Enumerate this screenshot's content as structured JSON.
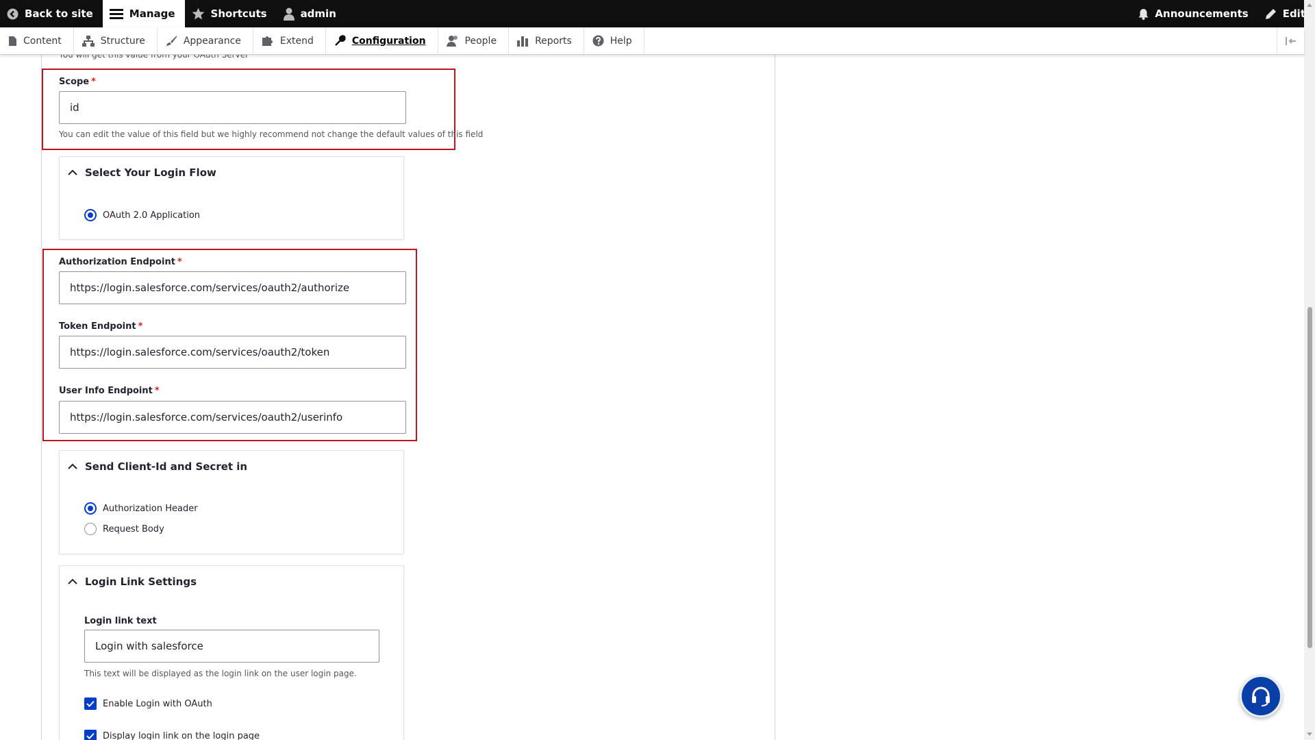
{
  "toolbar": {
    "back": "Back to site",
    "manage": "Manage",
    "shortcuts": "Shortcuts",
    "user": "admin",
    "announcements": "Announcements",
    "edit": "Edit"
  },
  "tray": {
    "items": [
      {
        "label": "Content",
        "icon": "file-icon"
      },
      {
        "label": "Structure",
        "icon": "sitemap-icon"
      },
      {
        "label": "Appearance",
        "icon": "paintbrush-icon"
      },
      {
        "label": "Extend",
        "icon": "puzzle-icon"
      },
      {
        "label": "Configuration",
        "icon": "wrench-icon",
        "active": true
      },
      {
        "label": "People",
        "icon": "people-icon"
      },
      {
        "label": "Reports",
        "icon": "bar-chart-icon"
      },
      {
        "label": "Help",
        "icon": "question-icon"
      }
    ]
  },
  "form": {
    "cut_off_desc": "You will get this value from your OAuth Server",
    "scope": {
      "label": "Scope",
      "required_mark": "*",
      "value": "id",
      "description": "You can edit the value of this field but we highly recommend not change the default values of this field"
    },
    "login_flow": {
      "title": "Select Your Login Flow",
      "options": [
        "OAuth 2.0 Application"
      ]
    },
    "authorization_endpoint": {
      "label": "Authorization Endpoint",
      "value": "https://login.salesforce.com/services/oauth2/authorize"
    },
    "token_endpoint": {
      "label": "Token Endpoint",
      "value": "https://login.salesforce.com/services/oauth2/token"
    },
    "userinfo_endpoint": {
      "label": "User Info Endpoint",
      "value": "https://login.salesforce.com/services/oauth2/userinfo"
    },
    "client_secret": {
      "title": "Send Client-Id and Secret in",
      "options": [
        "Authorization Header",
        "Request Body"
      ],
      "selected": "Authorization Header"
    },
    "login_link": {
      "title": "Login Link Settings",
      "text_label": "Login link text",
      "text_value": "Login with salesforce",
      "text_description": "This text will be displayed as the login link on the user login page.",
      "enable_label": "Enable Login with OAuth",
      "display_label": "Display login link on the login page"
    }
  },
  "colors": {
    "toolbar_bg": "#0f0f0f",
    "accent": "#003ecc",
    "highlight_border": "#c0141d",
    "required": "#dc2323",
    "help_button": "#0b3fa8"
  }
}
